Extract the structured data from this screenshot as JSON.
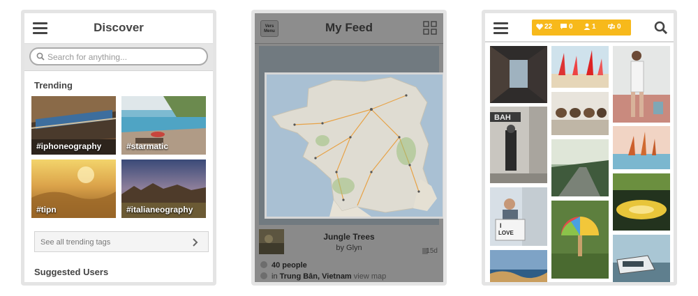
{
  "discover": {
    "title": "Discover",
    "search_placeholder": "Search for anything...",
    "trending_heading": "Trending",
    "tags": [
      "#iphoneography",
      "#starmatic",
      "#tipn",
      "#italianeography"
    ],
    "see_all_label": "See all trending tags",
    "suggested_heading": "Suggested Users"
  },
  "feed": {
    "menu_label_1": "Vers",
    "menu_label_2": "Menu",
    "title": "My Feed",
    "post_title": "Jungle Trees",
    "post_author": "by Glyn",
    "age": "15d",
    "likes": "40 people",
    "location_prefix": "in",
    "location": "Trung Bân, Vietnam",
    "view_map": "view map"
  },
  "grid": {
    "likes": "22",
    "comments": "0",
    "followers": "1",
    "reposts": "0",
    "accent_color": "#f7b91b"
  }
}
